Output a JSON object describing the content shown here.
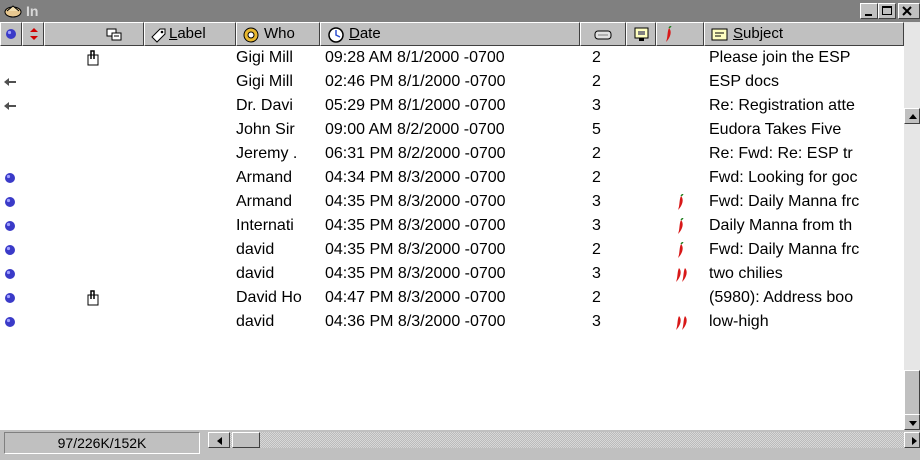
{
  "window": {
    "title": "In",
    "title_bar_color": "#808080",
    "icons": [
      "mailbox-icon",
      "minimize-icon",
      "maximize-icon",
      "close-icon"
    ]
  },
  "columns": {
    "status_icon": "status-dot-icon",
    "priority_icon": "priority-arrows-icon",
    "attachment_icon": "attachment-icon",
    "label": "Label",
    "who": "Who",
    "date": "Date",
    "size_icon": "size-icon",
    "server_icon": "server-icon",
    "mood_icon": "chili-icon",
    "subject": "Subject"
  },
  "messages": [
    {
      "status": "",
      "attachment": true,
      "who": "Gigi Mill",
      "date": "09:28 AM 8/1/2000 -0700",
      "size": "2",
      "mood": 0,
      "subject": "Please join the ESP"
    },
    {
      "status": "forwarded",
      "attachment": false,
      "who": "Gigi Mill",
      "date": "02:46 PM 8/1/2000 -0700",
      "size": "2",
      "mood": 0,
      "subject": "ESP docs"
    },
    {
      "status": "forwarded",
      "attachment": false,
      "who": "Dr. Davi",
      "date": "05:29 PM 8/1/2000 -0700",
      "size": "3",
      "mood": 0,
      "subject": "Re: Registration atte"
    },
    {
      "status": "",
      "attachment": false,
      "who": "John Sir",
      "date": "09:00 AM 8/2/2000 -0700",
      "size": "5",
      "mood": 0,
      "subject": "Eudora Takes Five"
    },
    {
      "status": "",
      "attachment": false,
      "who": "Jeremy .",
      "date": "06:31 PM 8/2/2000 -0700",
      "size": "2",
      "mood": 0,
      "subject": "Re: Fwd: Re: ESP tr"
    },
    {
      "status": "unread",
      "attachment": false,
      "who": "Armand",
      "date": "04:34 PM 8/3/2000 -0700",
      "size": "2",
      "mood": 0,
      "subject": "Fwd: Looking for goc"
    },
    {
      "status": "unread",
      "attachment": false,
      "who": "Armand",
      "date": "04:35 PM 8/3/2000 -0700",
      "size": "3",
      "mood": 1,
      "subject": "Fwd: Daily Manna frc"
    },
    {
      "status": "unread",
      "attachment": false,
      "who": "Internati",
      "date": "04:35 PM 8/3/2000 -0700",
      "size": "3",
      "mood": 1,
      "subject": "Daily Manna from th"
    },
    {
      "status": "unread",
      "attachment": false,
      "who": "david",
      "date": "04:35 PM 8/3/2000 -0700",
      "size": "2",
      "mood": 1,
      "subject": "Fwd: Daily Manna frc"
    },
    {
      "status": "unread",
      "attachment": false,
      "who": "david",
      "date": "04:35 PM 8/3/2000 -0700",
      "size": "3",
      "mood": 2,
      "subject": "two chilies"
    },
    {
      "status": "unread",
      "attachment": true,
      "who": "David Ho",
      "date": "04:47 PM 8/3/2000 -0700",
      "size": "2",
      "mood": 0,
      "subject": "(5980): Address boo"
    },
    {
      "status": "unread",
      "attachment": false,
      "who": "david",
      "date": "04:36 PM 8/3/2000 -0700",
      "size": "3",
      "mood": 2,
      "subject": "low-high"
    }
  ],
  "status_bar": {
    "size_info": "97/226K/152K"
  },
  "colors": {
    "unread_dot": "#3a3ac8",
    "chili": "#d81818",
    "window_bg": "#c0c0c0"
  }
}
